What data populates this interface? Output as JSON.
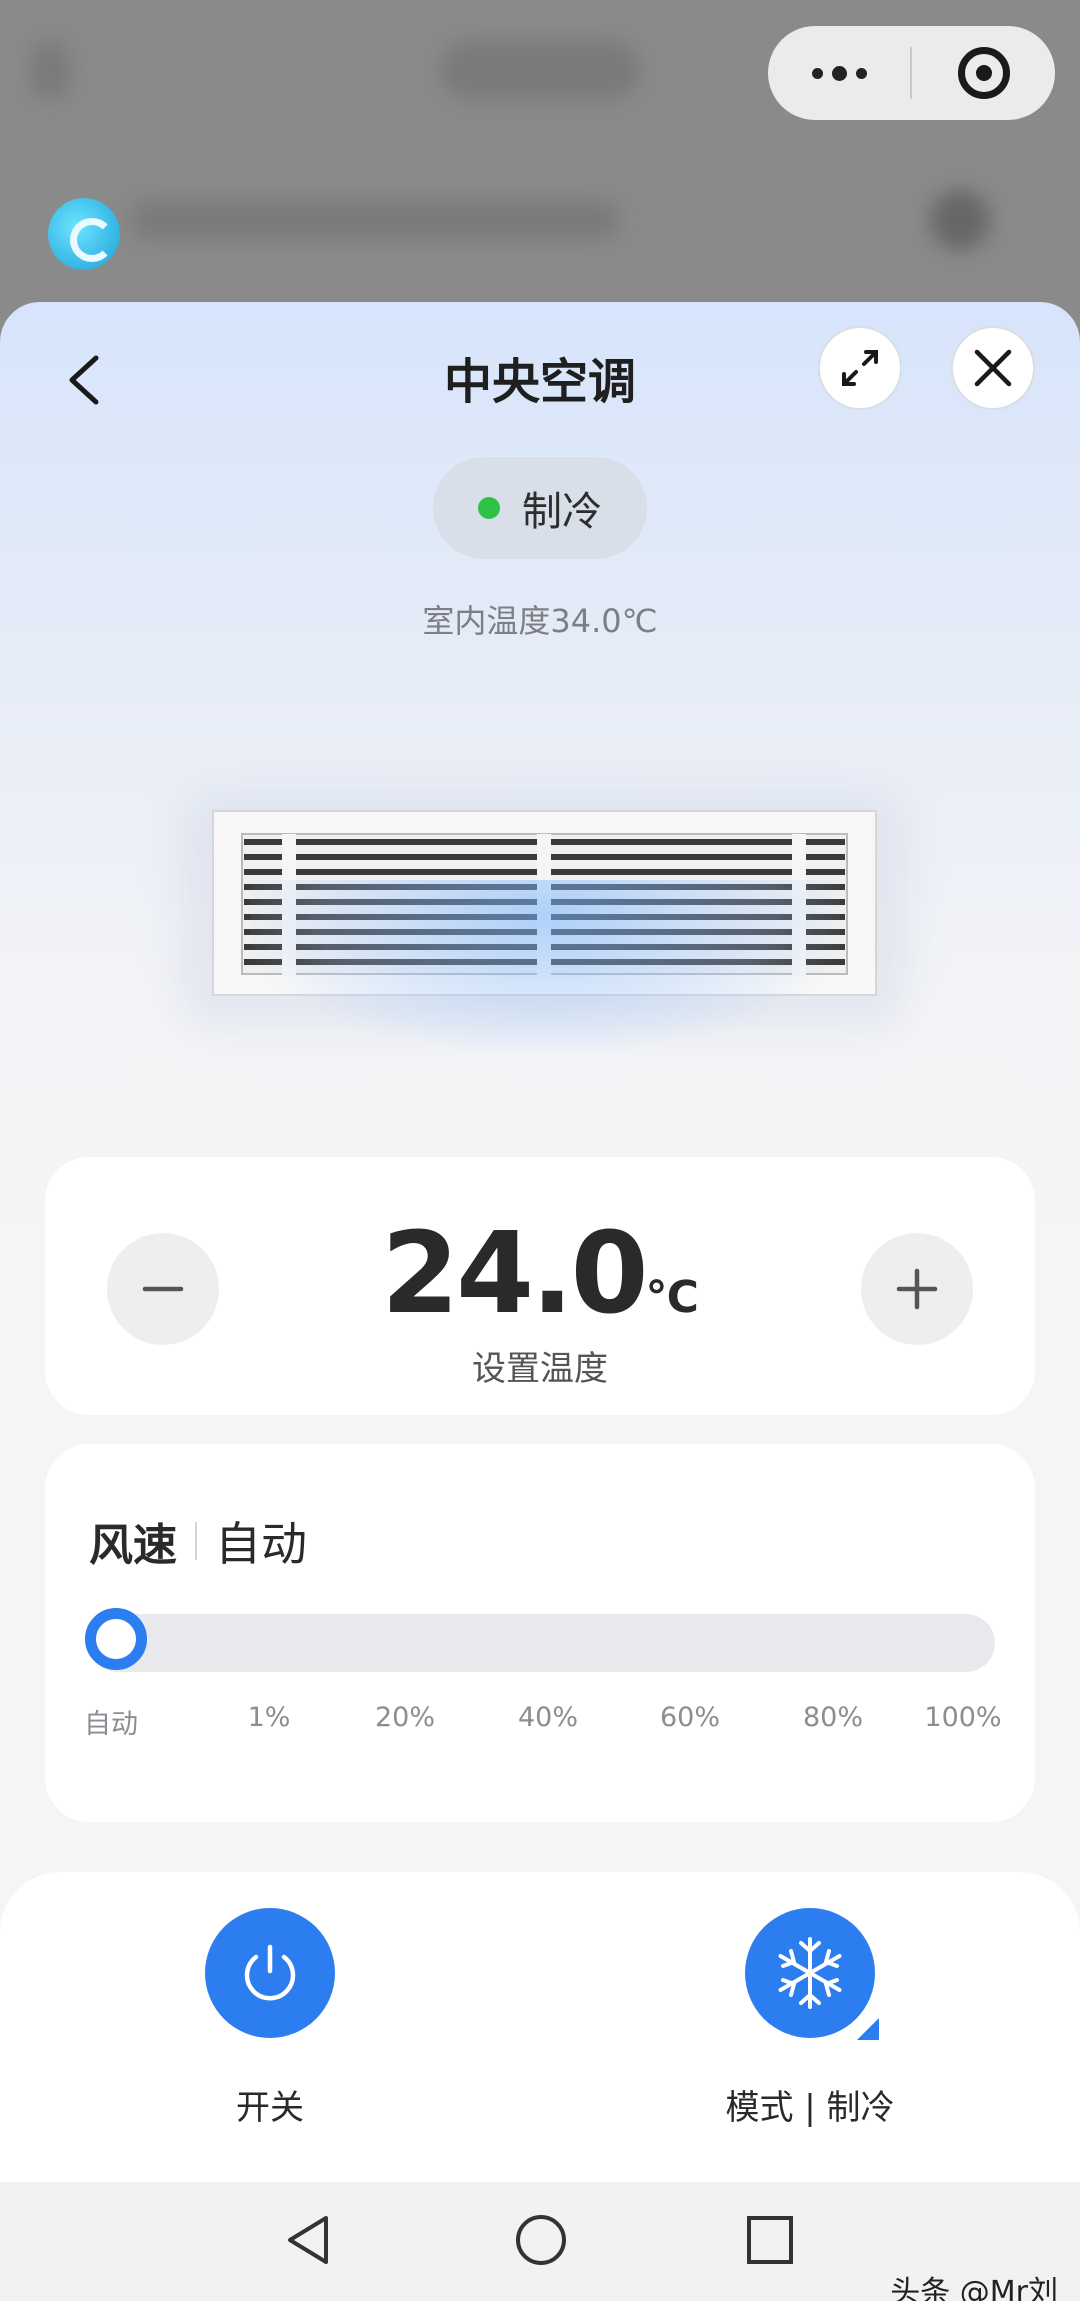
{
  "device": {
    "title": "中央空调",
    "status": "制冷",
    "status_color": "#2fc046",
    "indoor_temp": "室内温度34.0℃"
  },
  "temperature": {
    "value": "24.0",
    "unit": "℃",
    "label": "设置温度",
    "decrease_icon": "minus-icon",
    "increase_icon": "plus-icon"
  },
  "fan": {
    "label": "风速",
    "value": "自动",
    "level": 0,
    "ticks": [
      "自动",
      "1%",
      "20%",
      "40%",
      "60%",
      "80%",
      "100%"
    ]
  },
  "actions": {
    "power_label": "开关",
    "mode_label": "模式 | 制冷"
  },
  "colors": {
    "accent": "#2c7ef0",
    "status_dot": "#2fc046"
  },
  "icons": {
    "back": "chevron-left-icon",
    "expand": "expand-icon",
    "close": "close-icon",
    "power": "power-icon",
    "mode": "snowflake-icon",
    "capsule_more": "more-icon",
    "capsule_target": "target-icon"
  },
  "watermark": "头条 @Mr刘"
}
